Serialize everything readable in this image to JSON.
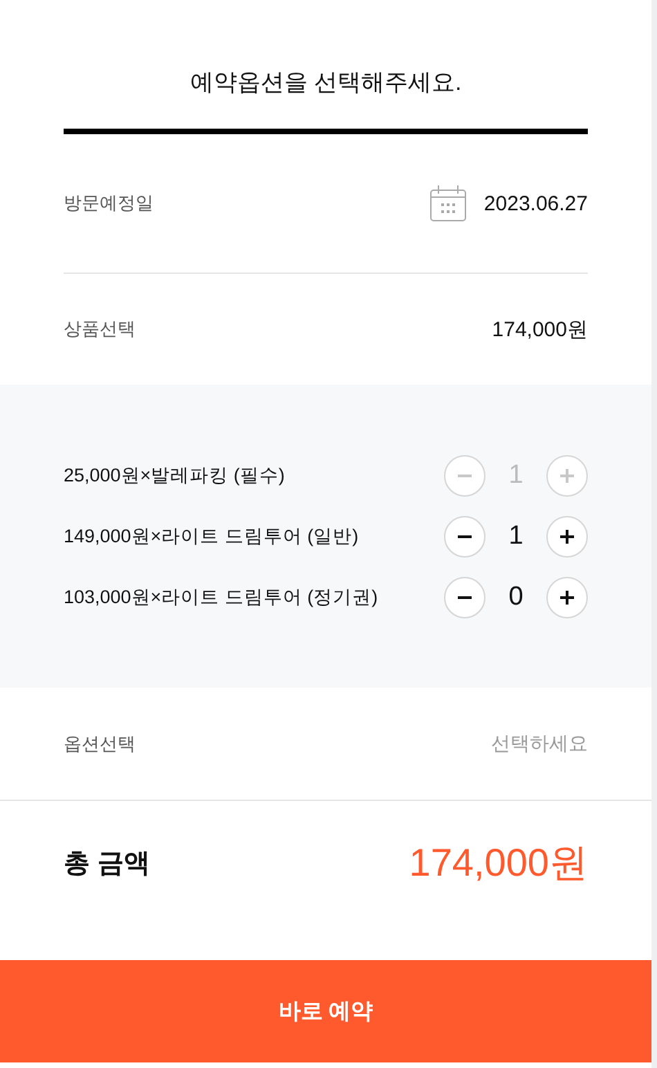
{
  "title": "예약옵션을 선택해주세요.",
  "visit_date": {
    "label": "방문예정일",
    "value": "2023.06.27"
  },
  "product": {
    "label": "상품선택",
    "value": "174,000원"
  },
  "items": [
    {
      "label": "25,000원×발레파킹 (필수)",
      "quantity": "1",
      "disabled": true
    },
    {
      "label": "149,000원×라이트 드림투어 (일반)",
      "quantity": "1",
      "disabled": false
    },
    {
      "label": "103,000원×라이트 드림투어 (정기권)",
      "quantity": "0",
      "disabled": false
    }
  ],
  "option": {
    "label": "옵션선택",
    "placeholder": "선택하세요"
  },
  "total": {
    "label": "총 금액",
    "value": "174,000원"
  },
  "button": "바로 예약"
}
